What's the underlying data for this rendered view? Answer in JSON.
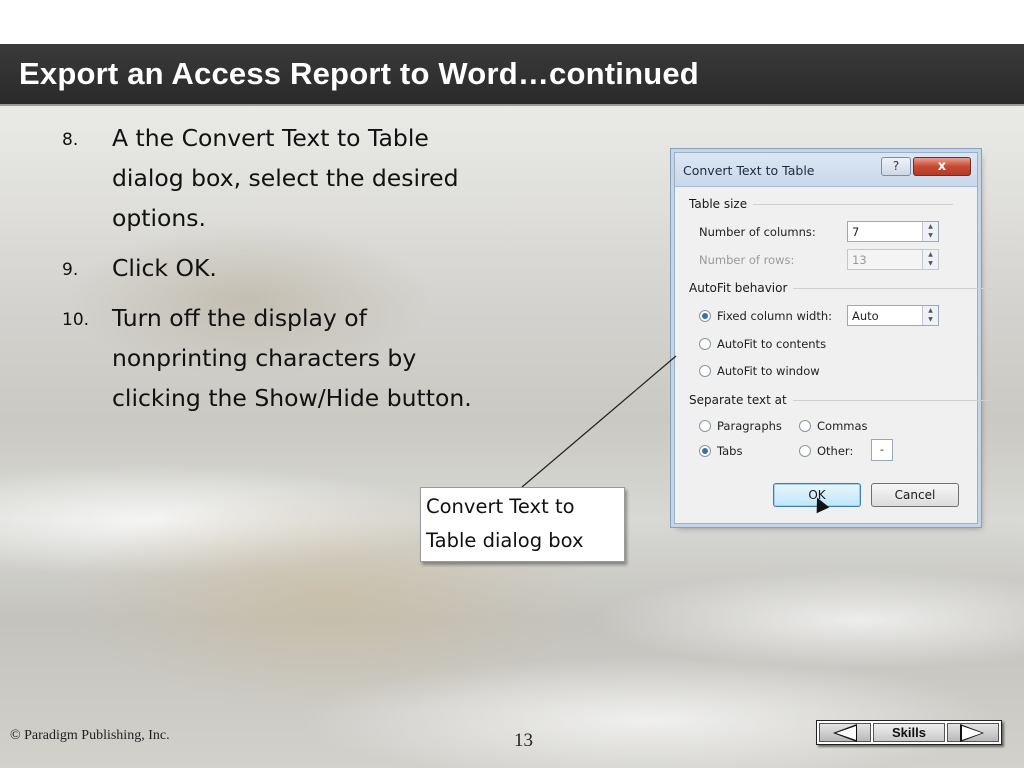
{
  "slide": {
    "title": "Export an Access Report to Word…continued",
    "steps": [
      {
        "num": "8.",
        "text": "A the Convert Text to Table dialog box, select the desired options."
      },
      {
        "num": "9.",
        "text": "Click OK."
      },
      {
        "num": "10.",
        "text": "Turn off the display of nonprinting characters by clicking the Show/Hide button."
      }
    ]
  },
  "dialog": {
    "title": "Convert Text to Table",
    "help_label": "?",
    "close_label": "x",
    "table_size_label": "Table size",
    "columns_label": "Number of columns:",
    "columns_value": "7",
    "rows_label": "Number of rows:",
    "rows_value": "13",
    "autofit_label": "AutoFit behavior",
    "fixed_width_label": "Fixed column width:",
    "fixed_width_value": "Auto",
    "autofit_contents_label": "AutoFit to contents",
    "autofit_window_label": "AutoFit to window",
    "separate_label": "Separate text at",
    "paragraphs_label": "Paragraphs",
    "commas_label": "Commas",
    "tabs_label": "Tabs",
    "other_label": "Other:",
    "other_value": "-",
    "ok_label": "OK",
    "cancel_label": "Cancel"
  },
  "callout": {
    "text": "Convert Text to Table dialog box"
  },
  "footer": {
    "copyright": "© Paradigm Publishing, Inc.",
    "page_number": "13",
    "skills_label": "Skills"
  }
}
